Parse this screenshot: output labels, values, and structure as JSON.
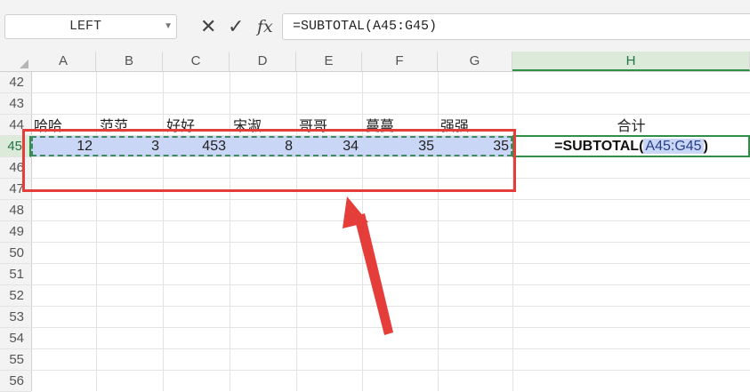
{
  "formula_bar": {
    "name_box": "LEFT",
    "cancel_icon": "close-icon",
    "enter_icon": "check-icon",
    "fx_label": "fx",
    "formula": "=SUBTOTAL(A45:G45)"
  },
  "columns": [
    "A",
    "B",
    "C",
    "D",
    "E",
    "F",
    "G",
    "H"
  ],
  "rows": [
    "42",
    "43",
    "44",
    "45",
    "46",
    "47",
    "48",
    "49",
    "50",
    "51",
    "52",
    "53",
    "54",
    "55",
    "56"
  ],
  "active_row": "45",
  "active_column": "H",
  "cells": {
    "row44": [
      "哈哈",
      "范范",
      "好好",
      "宋淑",
      "哥哥",
      "蔓蔓",
      "强强"
    ],
    "row44_h": "合计",
    "row45": [
      "12",
      "3",
      "453",
      "8",
      "34",
      "35",
      "35"
    ],
    "h45_prefix": "=SUBTOTAL(",
    "h45_range": "A45:G45",
    "h45_suffix": ")"
  },
  "colors": {
    "selection_fill": "#c9d6f5",
    "active_border": "#2f8f46",
    "annotation_red": "#e53d3a"
  }
}
